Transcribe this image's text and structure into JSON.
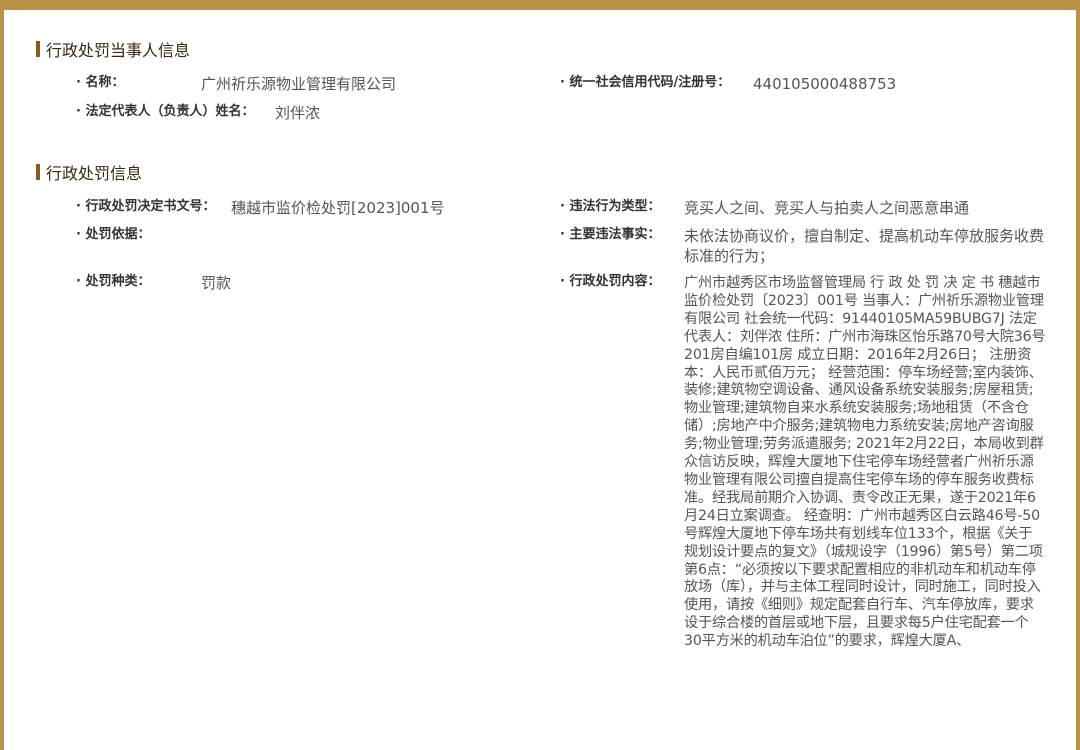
{
  "party_section": {
    "title": "行政处罚当事人信息",
    "name_label": "· 名称：",
    "name_value": "广州祈乐源物业管理有限公司",
    "credit_code_label": "· 统一社会信用代码/注册号：",
    "credit_code_value": "440105000488753",
    "rep_label": "· 法定代表人（负责人）姓名：",
    "rep_value": "刘伴浓"
  },
  "penalty_section": {
    "title": "行政处罚信息",
    "doc_no_label": "· 行政处罚决定书文号：",
    "doc_no_value": "穗越市监价检处罚[2023]001号",
    "violation_type_label": "· 违法行为类型：",
    "violation_type_value": "竞买人之间、竞买人与拍卖人之间恶意串通",
    "basis_label": "· 处罚依据：",
    "basis_value": "",
    "facts_label": "· 主要违法事实：",
    "facts_value": "未依法协商议价，擅自制定、提高机动车停放服务收费标准的行为；",
    "kind_label": "· 处罚种类：",
    "kind_value": "罚款",
    "content_label": "· 行政处罚内容：",
    "content_value": "广州市越秀区市场监督管理局 行 政 处 罚 决 定 书 穗越市监价检处罚〔2023〕001号 当事人：广州祈乐源物业管理有限公司 社会统一代码：91440105MA59BUBG7J 法定代表人：刘伴浓 住所：广州市海珠区怡乐路70号大院36号201房自编101房 成立日期：2016年2月26日； 注册资本：人民币贰佰万元； 经营范围：停车场经营;室内装饰、装修;建筑物空调设备、通风设备系统安装服务;房屋租赁;物业管理;建筑物自来水系统安装服务;场地租赁（不含仓储）;房地产中介服务;建筑物电力系统安装;房地产咨询服务;物业管理;劳务派遣服务; 2021年2月22日，本局收到群众信访反映，辉煌大厦地下住宅停车场经营者广州祈乐源物业管理有限公司擅自提高住宅停车场的停车服务收费标准。经我局前期介入协调、责令改正无果，遂于2021年6月24日立案调查。 经查明：广州市越秀区白云路46号-50号辉煌大厦地下停车场共有划线车位133个，根据《关于规划设计要点的复文》（城规设字（1996）第5号）第二项第6点：“必须按以下要求配置相应的非机动车和机动车停放场（库），并与主体工程同时设计，同时施工，同时投入使用，请按《细则》规定配套自行车、汽车停放库，要求设于综合楼的首层或地下层，且要求每5户住宅配套一个30平方米的机动车泊位”的要求，辉煌大厦A、"
  }
}
